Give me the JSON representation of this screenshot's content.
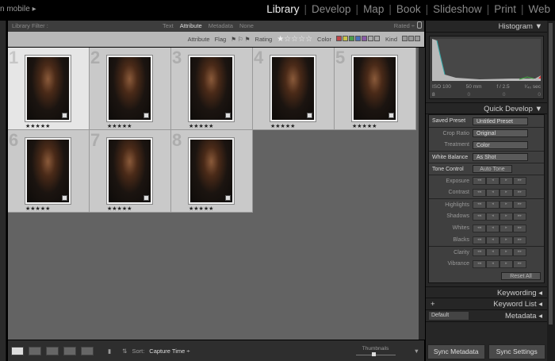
{
  "identity": "n mobile ▸",
  "modules": [
    "Library",
    "Develop",
    "Map",
    "Book",
    "Slideshow",
    "Print",
    "Web"
  ],
  "active_module": "Library",
  "filter": {
    "label": "Library Filter :",
    "tabs": [
      "Text",
      "Attribute",
      "Metadata",
      "None"
    ],
    "active": "Attribute",
    "rated": "Rated ÷"
  },
  "attribute_bar": {
    "attribute": "Attribute",
    "flag": "Flag",
    "rating": "Rating",
    "rating_stars": "★☆☆☆☆",
    "color": "Color",
    "kind": "Kind",
    "colors": [
      "#c0464a",
      "#c8c248",
      "#4c9c4a",
      "#4a6fb8",
      "#8a5aa8",
      "#aaaaaa",
      "#aaaaaa"
    ]
  },
  "grid": {
    "cells": [
      {
        "n": "1",
        "stars": "★★★★★",
        "selected": true
      },
      {
        "n": "2",
        "stars": "★★★★★"
      },
      {
        "n": "3",
        "stars": "★★★★★"
      },
      {
        "n": "4",
        "stars": "★★★★★"
      },
      {
        "n": "5",
        "stars": "★★★★★"
      },
      {
        "n": "6",
        "stars": "★★★★★"
      },
      {
        "n": "7",
        "stars": "★★★★★"
      },
      {
        "n": "8",
        "stars": "★★★★★"
      }
    ]
  },
  "toolbar": {
    "sort_label": "Sort:",
    "sort_value": "Capture Time ÷",
    "thumbnails": "Thumbnails"
  },
  "histogram": {
    "title": "Histogram ▼",
    "iso": "ISO 100",
    "focal": "50 mm",
    "aperture": "f / 2.5",
    "shutter": "¹⁄₄₀ sec",
    "counts": [
      "8",
      "0",
      "0",
      "0"
    ]
  },
  "quick_develop": {
    "title": "Quick Develop ▼",
    "saved_preset_label": "Saved Preset",
    "saved_preset": "Untitled Preset",
    "crop_label": "Crop Ratio",
    "crop": "Original",
    "treatment_label": "Treatment",
    "treatment": "Color",
    "wb_label": "White Balance",
    "wb": "As Shot",
    "tone_label": "Tone Control",
    "auto_tone": "Auto Tone",
    "adjust": [
      "Exposure",
      "Contrast",
      "Highlights",
      "Shadows",
      "Whites",
      "Blacks",
      "Clarity",
      "Vibrance"
    ],
    "reset": "Reset All"
  },
  "panels": {
    "keywording": "Keywording ◂",
    "keyword_list": "Keyword List ◂",
    "metadata": "Metadata ◂",
    "metadata_preset": "Default"
  },
  "sync": {
    "metadata": "Sync Metadata",
    "settings": "Sync Settings"
  }
}
